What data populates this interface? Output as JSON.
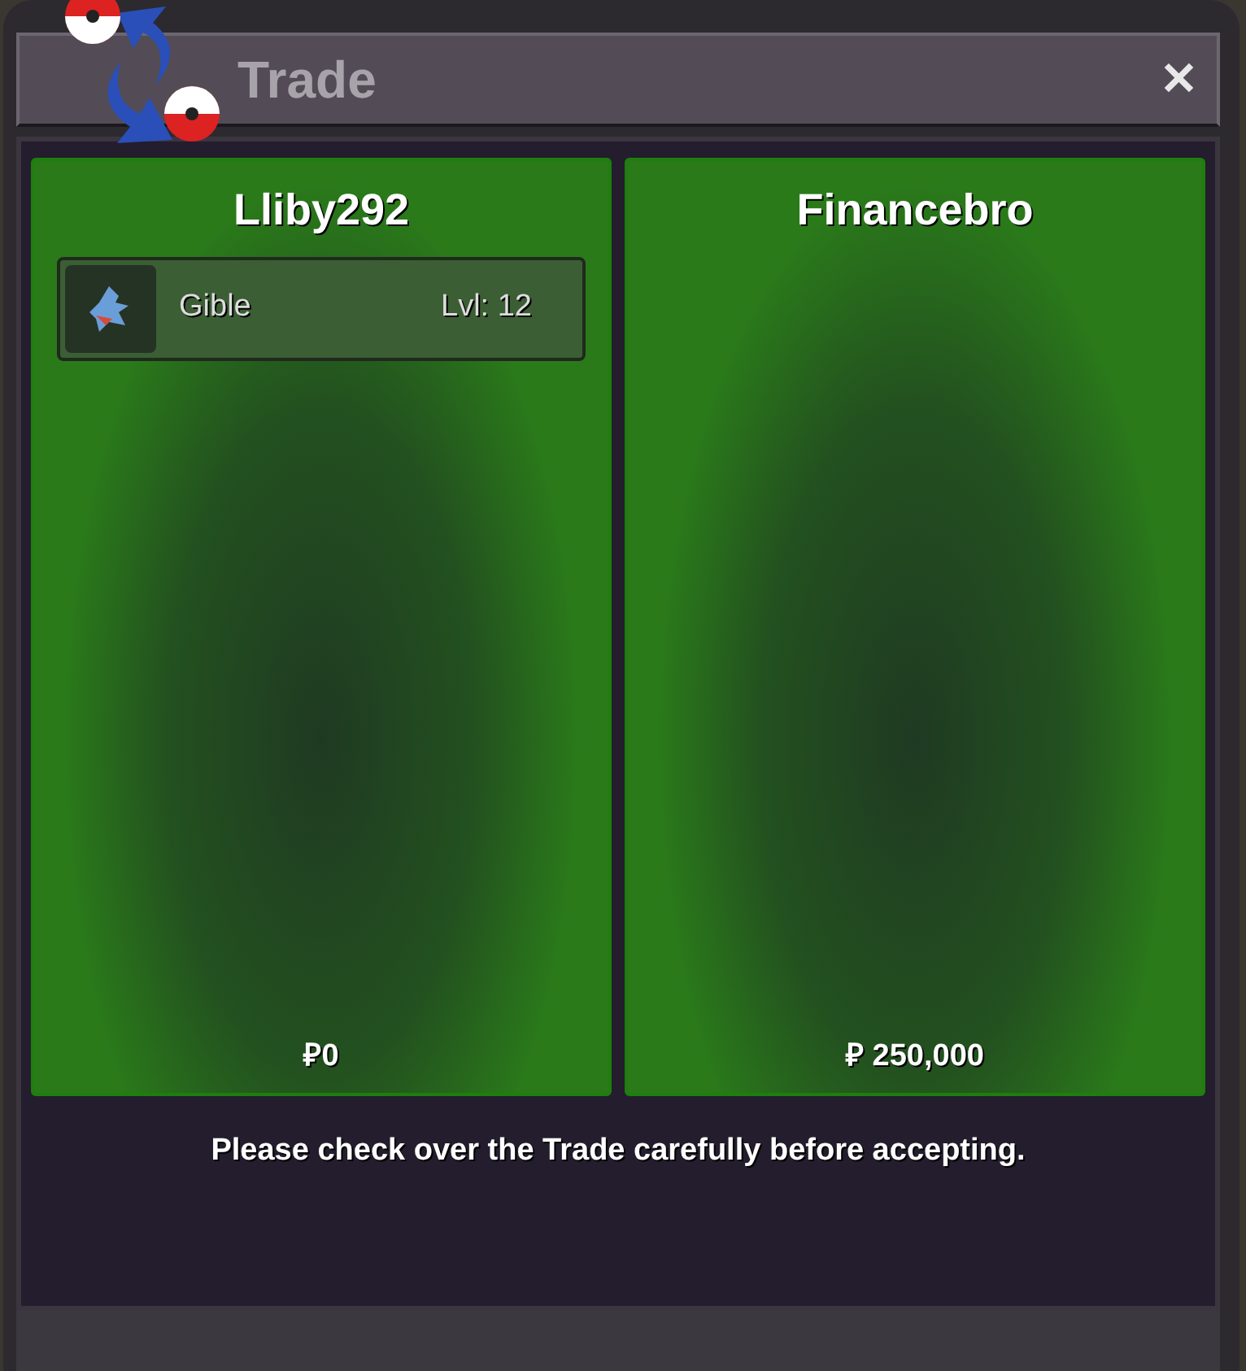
{
  "window": {
    "title": "Trade",
    "close": "✕"
  },
  "panels": [
    {
      "player": "Lliby292",
      "pokemon": [
        {
          "name": "Gible",
          "level": "Lvl: 12"
        }
      ],
      "money": "₽0"
    },
    {
      "player": "Financebro",
      "money": "₽ 250,000"
    }
  ],
  "notice": "Please check over the Trade carefully before accepting."
}
